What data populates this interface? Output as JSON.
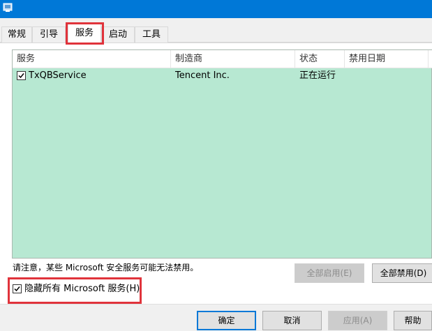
{
  "tabs": [
    {
      "label": "常规"
    },
    {
      "label": "引导"
    },
    {
      "label": "服务",
      "active": true
    },
    {
      "label": "启动"
    },
    {
      "label": "工具"
    }
  ],
  "services": {
    "columns": [
      "服务",
      "制造商",
      "状态",
      "禁用日期"
    ],
    "rows": [
      {
        "checked": true,
        "name": "TxQBService",
        "vendor": "Tencent Inc.",
        "status": "正在运行",
        "disabled_date": ""
      }
    ],
    "list_bg_color": "#b7e8d2"
  },
  "note": "请注意，某些 Microsoft 安全服务可能无法禁用。",
  "buttons": {
    "enable_all": "全部启用(E)",
    "disable_all": "全部禁用(D)",
    "ok": "确定",
    "cancel": "取消",
    "apply": "应用(A)",
    "help": "帮助"
  },
  "hide_microsoft": {
    "checked": true,
    "label": "隐藏所有 Microsoft 服务(H)"
  },
  "colors": {
    "accent": "#0078d7",
    "highlight_box": "#e0333b"
  }
}
